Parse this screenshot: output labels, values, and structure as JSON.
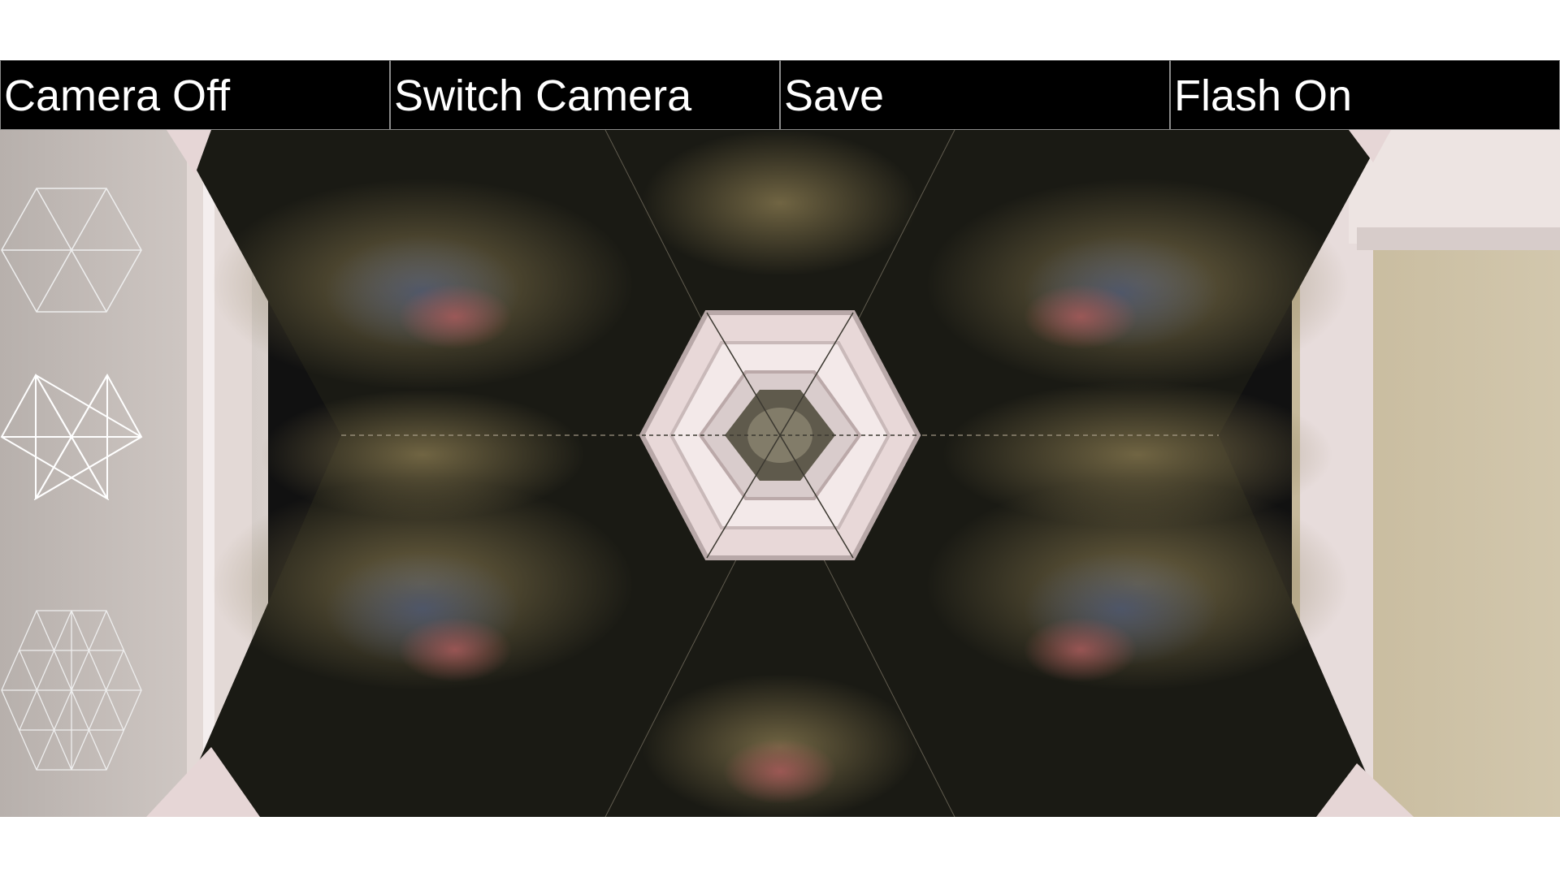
{
  "toolbar": {
    "camera_off_label": "Camera Off",
    "switch_camera_label": "Switch Camera",
    "save_label": "Save",
    "flash_label": "Flash On"
  },
  "mode_panel": {
    "items": [
      {
        "icon": "hexagon-6-triangles-icon"
      },
      {
        "icon": "star-of-david-grid-icon"
      },
      {
        "icon": "hexagon-triangle-grid-icon"
      }
    ]
  },
  "colors": {
    "toolbar_bg": "#000000",
    "toolbar_text": "#ffffff",
    "toolbar_border": "#8a8a8a",
    "frame_pink": "#e6d6d6",
    "wall_beige": "#c9bda2",
    "pattern_dark": "#1a1a14",
    "pattern_olive": "#6e6342"
  }
}
